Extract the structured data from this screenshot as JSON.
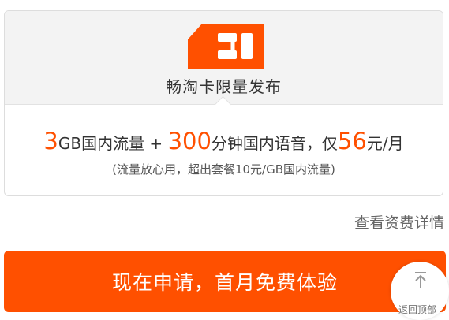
{
  "colors": {
    "accent": "#ff5000",
    "card_header_bg": "#f3f3f3"
  },
  "card": {
    "icon": "sim-card-icon",
    "title": "畅淘卡限量发布",
    "plan": {
      "data_amount": "3",
      "data_text": "GB国内流量 + ",
      "minutes": "300",
      "minutes_text": "分钟国内语音，仅",
      "price": "56",
      "price_unit": "元/月"
    },
    "note": "(流量放心用，超出套餐10元/GB国内流量)"
  },
  "details_link": "查看资费详情",
  "apply_button": "现在申请，首月免费体验",
  "back_to_top": {
    "icon": "arrow-up-icon",
    "label": "返回顶部"
  }
}
